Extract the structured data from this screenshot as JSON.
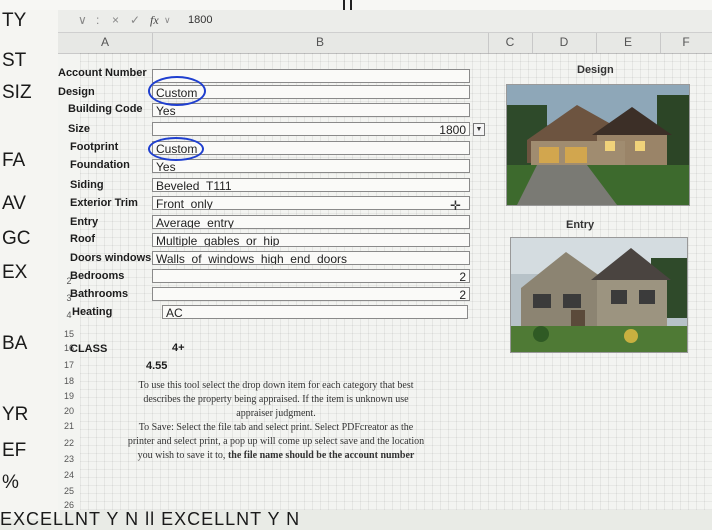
{
  "paper": {
    "left_rows": [
      "TY",
      "ST",
      "SIZ",
      "FA",
      "AV",
      "GC",
      "EX",
      "BA",
      "YR",
      "EF",
      "%"
    ],
    "bottom_text": "EXCELLNT     Y   N         ll   EXCELLNT       Y   N"
  },
  "formula_bar": {
    "controls": [
      "∨",
      ":",
      "×",
      "✓"
    ],
    "fx_label": "fx",
    "value": "1800"
  },
  "columns": [
    "A",
    "B",
    "C",
    "D",
    "E",
    "F"
  ],
  "rows": {
    "numbers": [
      "",
      "",
      "",
      "",
      "",
      "",
      "",
      "",
      "",
      "",
      "",
      "",
      "",
      "15",
      "16",
      "17",
      "18",
      "19",
      "20",
      "21",
      "22",
      "23",
      "24",
      "25",
      "26"
    ]
  },
  "form": [
    {
      "label": "Account Number",
      "value": ""
    },
    {
      "label": "Design",
      "value": "Custom"
    },
    {
      "label": "Building Code",
      "value": "Yes"
    },
    {
      "label": "Size",
      "value": "1800"
    },
    {
      "label": "Footprint",
      "value": "Custom"
    },
    {
      "label": "Foundation",
      "value": "Yes"
    },
    {
      "label": "Siding",
      "value": "Beveled_T111"
    },
    {
      "label": "Exterior Trim",
      "value": "Front_only"
    },
    {
      "label": "Entry",
      "value": "Average_entry"
    },
    {
      "label": "Roof",
      "value": "Multiple_gables_or_hip"
    },
    {
      "label": "Doors windows",
      "value": "Walls_of_windows_high_end_doors"
    },
    {
      "label": "Bedrooms",
      "value": "2"
    },
    {
      "label": "Bathrooms",
      "value": "2"
    },
    {
      "label": "Heating",
      "value": "AC"
    }
  ],
  "row_prefixes": [
    "2",
    "3",
    "4"
  ],
  "class": {
    "label": "CLASS",
    "value": "4+",
    "score": "4.55"
  },
  "instructions": {
    "line1": "To use this tool select the drop down item for each category that best",
    "line2": "describes the property being appraised.  If the item is unknown use",
    "line3": "appraiser judgment.",
    "line4": "To Save: Select the file tab and select print.  Select PDFcreator as the",
    "line5": "printer and select print, a pop up will come up select save and the location",
    "line6_plain": "you wish to save it to,",
    "line6_bold": "the file name should be the account number"
  },
  "pictures": {
    "design_title": "Design",
    "entry_title": "Entry"
  },
  "colors": {
    "annotation": "#1f3fcf",
    "cell_border": "#8a8a8a"
  }
}
